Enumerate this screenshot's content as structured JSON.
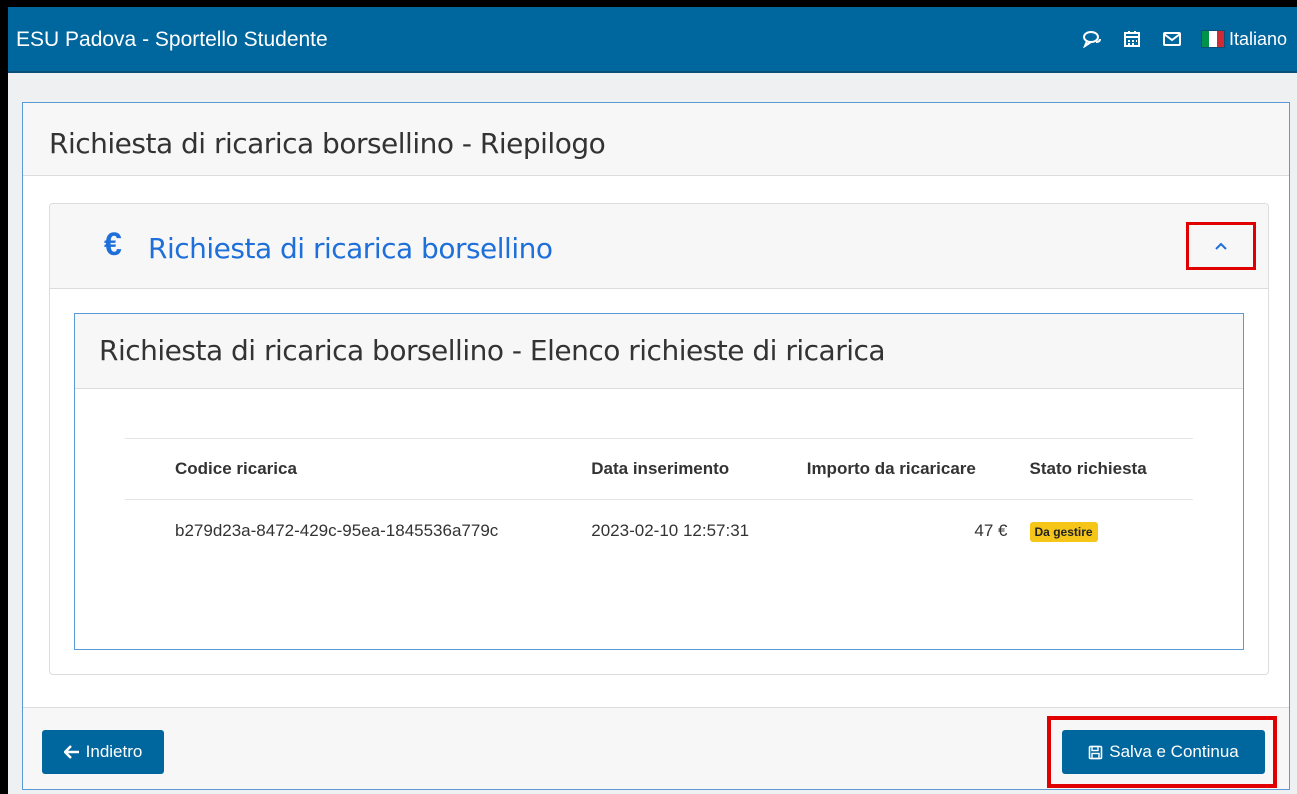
{
  "navbar": {
    "title": "ESU Padova - Sportello Studente",
    "icons": [
      "chat-icon",
      "calendar-icon",
      "mail-icon"
    ],
    "language": "Italiano"
  },
  "page": {
    "title": "Richiesta di ricarica borsellino - Riepilogo"
  },
  "section": {
    "icon": "€",
    "title": "Richiesta di ricarica borsellino"
  },
  "list": {
    "title": "Richiesta di ricarica borsellino - Elenco richieste di ricarica",
    "columns": [
      "Codice ricarica",
      "Data inserimento",
      "Importo da ricaricare",
      "Stato richiesta"
    ],
    "rows": [
      {
        "code": "b279d23a-8472-429c-95ea-1845536a779c",
        "date": "2023-02-10 12:57:31",
        "amount": "47 €",
        "status": "Da gestire"
      }
    ]
  },
  "footer": {
    "back_label": "Indietro",
    "save_label": "Salva e Continua"
  },
  "colors": {
    "primary": "#00669e",
    "link": "#1e6fd9",
    "highlight": "#e00000",
    "badge": "#f5c518"
  }
}
